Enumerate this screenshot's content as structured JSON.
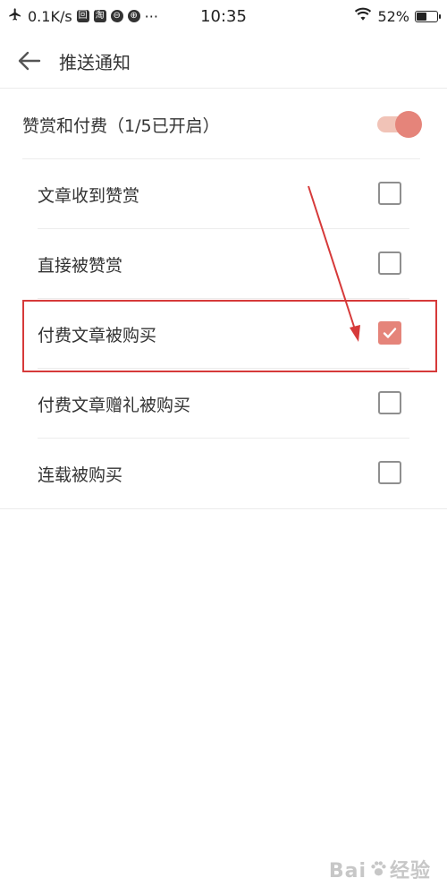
{
  "status_bar": {
    "network_speed": "0.1K/s",
    "time": "10:35",
    "battery_percent": "52%",
    "battery_level": 0.52,
    "notif_icons": [
      "回",
      "淘",
      "⊖",
      "⊕"
    ],
    "more": "···"
  },
  "header": {
    "title": "推送通知"
  },
  "main_toggle": {
    "label": "赞赏和付费（1/5已开启）",
    "on": true
  },
  "items": [
    {
      "label": "文章收到赞赏",
      "checked": false
    },
    {
      "label": "直接被赞赏",
      "checked": false
    },
    {
      "label": "付费文章被购买",
      "checked": true
    },
    {
      "label": "付费文章赠礼被购买",
      "checked": false
    },
    {
      "label": "连载被购买",
      "checked": false
    }
  ],
  "colors": {
    "accent": "#e5847a",
    "accent_light": "#f1c3b7",
    "annotation_red": "#d63a3a"
  },
  "watermark": {
    "text_left": "Bai",
    "text_right": "经验"
  }
}
